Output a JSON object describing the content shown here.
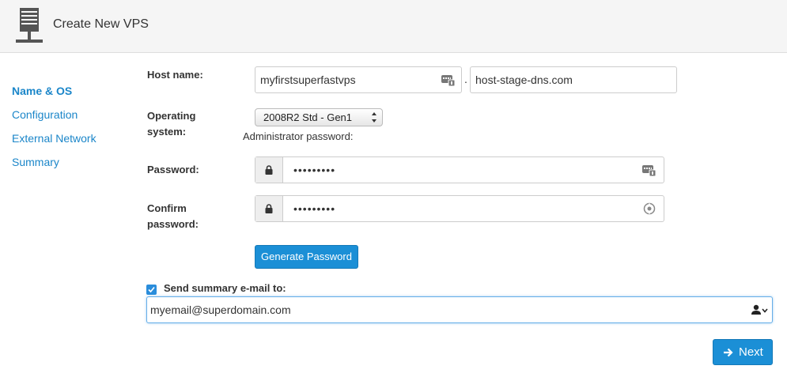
{
  "header": {
    "title": "Create New VPS",
    "icon": "server-icon"
  },
  "sidebar": {
    "items": [
      {
        "label": "Name & OS",
        "active": true
      },
      {
        "label": "Configuration",
        "active": false
      },
      {
        "label": "External Network",
        "active": false
      },
      {
        "label": "Summary",
        "active": false
      }
    ]
  },
  "form": {
    "host_label": "Host name:",
    "host_value": "myfirstsuperfastvps",
    "separator": ".",
    "domain_value": "host-stage-dns.com",
    "os_label_line1": "Operating",
    "os_label_line2": "system:",
    "os_selected": "2008R2 Std - Gen1",
    "admin_pw_caption": "Administrator password:",
    "password_label": "Password:",
    "password_value": "•••••••••",
    "confirm_label_line1": "Confirm",
    "confirm_label_line2": "password:",
    "confirm_value": "•••••••••",
    "generate_label": "Generate Password",
    "send_email_label": "Send summary e-mail to:",
    "send_email_checked": true,
    "email_value": "myemail@superdomain.com",
    "next_label": "Next"
  },
  "colors": {
    "accent": "#1b8fd6",
    "link": "#1b86c9",
    "header_bg": "#f5f5f5"
  }
}
